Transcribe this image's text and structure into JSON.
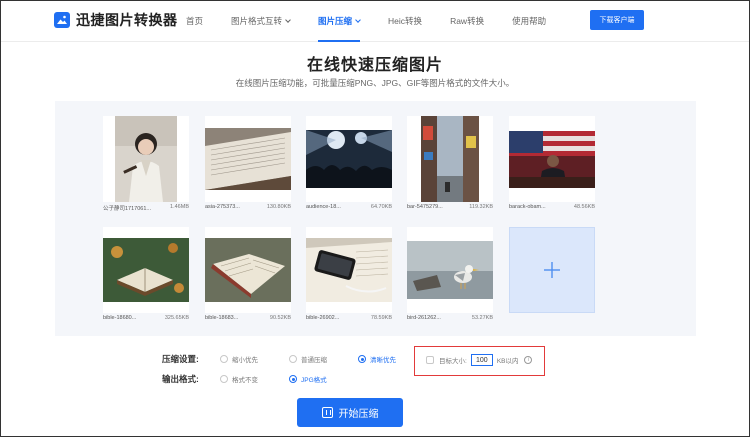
{
  "header": {
    "logo_text": "迅捷图片转换器",
    "nav": [
      {
        "label": "首页",
        "has_dropdown": false,
        "active": false
      },
      {
        "label": "图片格式互转",
        "has_dropdown": true,
        "active": false
      },
      {
        "label": "图片压缩",
        "has_dropdown": true,
        "active": true
      },
      {
        "label": "Heic转换",
        "has_dropdown": false,
        "active": false
      },
      {
        "label": "Raw转换",
        "has_dropdown": false,
        "active": false
      },
      {
        "label": "使用帮助",
        "has_dropdown": false,
        "active": false
      }
    ],
    "download_button": "下载客户端"
  },
  "page": {
    "title": "在线快速压缩图片",
    "subtitle": "在线图片压缩功能，可批量压缩PNG、JPG、GIF等图片格式的文件大小。"
  },
  "files": [
    {
      "name": "公子静司1717061...",
      "size": "1.46MB",
      "thumb": "portrait-photo"
    },
    {
      "name": "asia-275373...",
      "size": "130.80KB",
      "thumb": "book-pages"
    },
    {
      "name": "audience-18...",
      "size": "64.70KB",
      "thumb": "concert-crowd"
    },
    {
      "name": "bar-5475279...",
      "size": "119.32KB",
      "thumb": "city-street"
    },
    {
      "name": "barack-obam...",
      "size": "48.56KB",
      "thumb": "speech-flag"
    },
    {
      "name": "bible-18680...",
      "size": "325.65KB",
      "thumb": "open-book-leaves"
    },
    {
      "name": "bible-18683...",
      "size": "90.52KB",
      "thumb": "bible-pages"
    },
    {
      "name": "bible-26902...",
      "size": "78.59KB",
      "thumb": "phone-on-bible"
    },
    {
      "name": "bird-261262...",
      "size": "53.27KB",
      "thumb": "seagull"
    }
  ],
  "add_tile": {
    "icon": "plus-icon"
  },
  "options": {
    "compress_label": "压缩设置:",
    "compress_modes": [
      {
        "label": "缩小优先",
        "checked": false
      },
      {
        "label": "普通压缩",
        "checked": false
      },
      {
        "label": "清晰优先",
        "checked": true
      }
    ],
    "target_size_label": "目标大小:",
    "target_size_value": "100",
    "target_size_unit": "KB以内",
    "output_label": "输出格式:",
    "output_formats": [
      {
        "label": "格式不变",
        "checked": false
      },
      {
        "label": "JPG格式",
        "checked": true
      }
    ]
  },
  "start_button": "开始压缩",
  "colors": {
    "accent": "#1f6ff2",
    "highlight": "#e23a3a",
    "panel": "#f4f6fa"
  }
}
